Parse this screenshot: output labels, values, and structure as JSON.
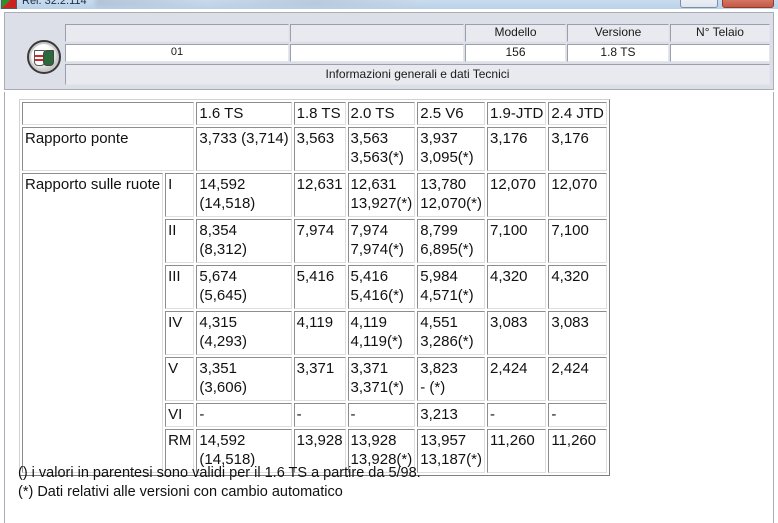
{
  "window": {
    "title": "Rel. 32.2.114",
    "colors": {
      "titlebar": "#c9dced",
      "header_bg": "#dcdfe7"
    }
  },
  "header": {
    "logo": "alfa-romeo-badge",
    "labels": {
      "model": "Modello",
      "version": "Versione",
      "chassis": "N° Telaio"
    },
    "values": {
      "code": "01",
      "model": "156",
      "version": "1.8 TS",
      "chassis": ""
    },
    "section_title": "Informazioni generali e dati Tecnici"
  },
  "table": {
    "columns": [
      "1.6 TS",
      "1.8 TS",
      "2.0 TS",
      "2.5 V6",
      "1.9-JTD",
      "2.4 JTD"
    ],
    "bridge_ratio": {
      "label": "Rapporto ponte",
      "values": [
        [
          "3,733 (3,714)"
        ],
        [
          "3,563"
        ],
        [
          "3,563",
          "3,563(*)"
        ],
        [
          "3,937",
          "3,095(*)"
        ],
        [
          "3,176"
        ],
        [
          "3,176"
        ]
      ]
    },
    "wheel_ratio": {
      "label": "Rapporto sulle ruote",
      "gears": [
        {
          "gear": "I",
          "values": [
            [
              "14,592",
              "(14,518)"
            ],
            [
              "12,631"
            ],
            [
              "12,631",
              "13,927(*)"
            ],
            [
              "13,780",
              "12,070(*)"
            ],
            [
              "12,070"
            ],
            [
              "12,070"
            ]
          ]
        },
        {
          "gear": "II",
          "values": [
            [
              "8,354",
              "(8,312)"
            ],
            [
              "7,974"
            ],
            [
              "7,974",
              "7,974(*)"
            ],
            [
              "8,799",
              "6,895(*)"
            ],
            [
              "7,100"
            ],
            [
              "7,100"
            ]
          ]
        },
        {
          "gear": "III",
          "values": [
            [
              "5,674",
              "(5,645)"
            ],
            [
              "5,416"
            ],
            [
              "5,416",
              "5,416(*)"
            ],
            [
              "5,984",
              "4,571(*)"
            ],
            [
              "4,320"
            ],
            [
              "4,320"
            ]
          ]
        },
        {
          "gear": "IV",
          "values": [
            [
              "4,315",
              "(4,293)"
            ],
            [
              "4,119"
            ],
            [
              "4,119",
              "4,119(*)"
            ],
            [
              "4,551",
              "3,286(*)"
            ],
            [
              "3,083"
            ],
            [
              "3,083"
            ]
          ]
        },
        {
          "gear": "V",
          "values": [
            [
              "3,351",
              "(3,606)"
            ],
            [
              "3,371"
            ],
            [
              "3,371",
              "3,371(*)"
            ],
            [
              "3,823",
              "- (*)"
            ],
            [
              "2,424"
            ],
            [
              "2,424"
            ]
          ]
        },
        {
          "gear": "VI",
          "values": [
            [
              "-"
            ],
            [
              "-"
            ],
            [
              "-"
            ],
            [
              "3,213"
            ],
            [
              "-"
            ],
            [
              "-"
            ]
          ]
        },
        {
          "gear": "RM",
          "values": [
            [
              "14,592",
              "(14,518)"
            ],
            [
              "13,928"
            ],
            [
              "13,928",
              "13,928(*)"
            ],
            [
              "13,957",
              "13,187(*)"
            ],
            [
              "11,260"
            ],
            [
              "11,260"
            ]
          ]
        }
      ]
    }
  },
  "notes": [
    "() i valori in parentesi sono validi per il 1.6 TS a partire da 5/98.",
    "(*) Dati relativi alle versioni con cambio automatico"
  ]
}
